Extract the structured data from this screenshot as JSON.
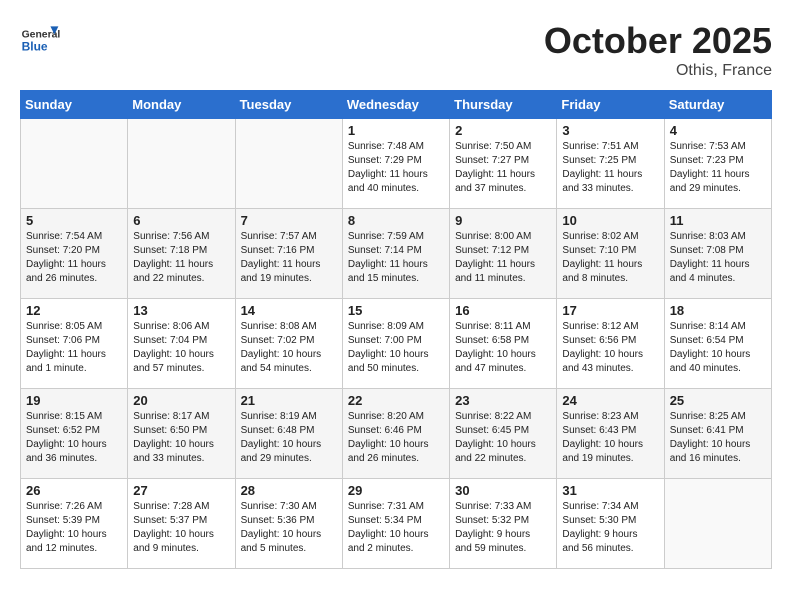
{
  "header": {
    "logo_general": "General",
    "logo_blue": "Blue",
    "month": "October 2025",
    "location": "Othis, France"
  },
  "weekdays": [
    "Sunday",
    "Monday",
    "Tuesday",
    "Wednesday",
    "Thursday",
    "Friday",
    "Saturday"
  ],
  "weeks": [
    [
      {
        "day": "",
        "data": ""
      },
      {
        "day": "",
        "data": ""
      },
      {
        "day": "",
        "data": ""
      },
      {
        "day": "1",
        "data": "Sunrise: 7:48 AM\nSunset: 7:29 PM\nDaylight: 11 hours\nand 40 minutes."
      },
      {
        "day": "2",
        "data": "Sunrise: 7:50 AM\nSunset: 7:27 PM\nDaylight: 11 hours\nand 37 minutes."
      },
      {
        "day": "3",
        "data": "Sunrise: 7:51 AM\nSunset: 7:25 PM\nDaylight: 11 hours\nand 33 minutes."
      },
      {
        "day": "4",
        "data": "Sunrise: 7:53 AM\nSunset: 7:23 PM\nDaylight: 11 hours\nand 29 minutes."
      }
    ],
    [
      {
        "day": "5",
        "data": "Sunrise: 7:54 AM\nSunset: 7:20 PM\nDaylight: 11 hours\nand 26 minutes."
      },
      {
        "day": "6",
        "data": "Sunrise: 7:56 AM\nSunset: 7:18 PM\nDaylight: 11 hours\nand 22 minutes."
      },
      {
        "day": "7",
        "data": "Sunrise: 7:57 AM\nSunset: 7:16 PM\nDaylight: 11 hours\nand 19 minutes."
      },
      {
        "day": "8",
        "data": "Sunrise: 7:59 AM\nSunset: 7:14 PM\nDaylight: 11 hours\nand 15 minutes."
      },
      {
        "day": "9",
        "data": "Sunrise: 8:00 AM\nSunset: 7:12 PM\nDaylight: 11 hours\nand 11 minutes."
      },
      {
        "day": "10",
        "data": "Sunrise: 8:02 AM\nSunset: 7:10 PM\nDaylight: 11 hours\nand 8 minutes."
      },
      {
        "day": "11",
        "data": "Sunrise: 8:03 AM\nSunset: 7:08 PM\nDaylight: 11 hours\nand 4 minutes."
      }
    ],
    [
      {
        "day": "12",
        "data": "Sunrise: 8:05 AM\nSunset: 7:06 PM\nDaylight: 11 hours\nand 1 minute."
      },
      {
        "day": "13",
        "data": "Sunrise: 8:06 AM\nSunset: 7:04 PM\nDaylight: 10 hours\nand 57 minutes."
      },
      {
        "day": "14",
        "data": "Sunrise: 8:08 AM\nSunset: 7:02 PM\nDaylight: 10 hours\nand 54 minutes."
      },
      {
        "day": "15",
        "data": "Sunrise: 8:09 AM\nSunset: 7:00 PM\nDaylight: 10 hours\nand 50 minutes."
      },
      {
        "day": "16",
        "data": "Sunrise: 8:11 AM\nSunset: 6:58 PM\nDaylight: 10 hours\nand 47 minutes."
      },
      {
        "day": "17",
        "data": "Sunrise: 8:12 AM\nSunset: 6:56 PM\nDaylight: 10 hours\nand 43 minutes."
      },
      {
        "day": "18",
        "data": "Sunrise: 8:14 AM\nSunset: 6:54 PM\nDaylight: 10 hours\nand 40 minutes."
      }
    ],
    [
      {
        "day": "19",
        "data": "Sunrise: 8:15 AM\nSunset: 6:52 PM\nDaylight: 10 hours\nand 36 minutes."
      },
      {
        "day": "20",
        "data": "Sunrise: 8:17 AM\nSunset: 6:50 PM\nDaylight: 10 hours\nand 33 minutes."
      },
      {
        "day": "21",
        "data": "Sunrise: 8:19 AM\nSunset: 6:48 PM\nDaylight: 10 hours\nand 29 minutes."
      },
      {
        "day": "22",
        "data": "Sunrise: 8:20 AM\nSunset: 6:46 PM\nDaylight: 10 hours\nand 26 minutes."
      },
      {
        "day": "23",
        "data": "Sunrise: 8:22 AM\nSunset: 6:45 PM\nDaylight: 10 hours\nand 22 minutes."
      },
      {
        "day": "24",
        "data": "Sunrise: 8:23 AM\nSunset: 6:43 PM\nDaylight: 10 hours\nand 19 minutes."
      },
      {
        "day": "25",
        "data": "Sunrise: 8:25 AM\nSunset: 6:41 PM\nDaylight: 10 hours\nand 16 minutes."
      }
    ],
    [
      {
        "day": "26",
        "data": "Sunrise: 7:26 AM\nSunset: 5:39 PM\nDaylight: 10 hours\nand 12 minutes."
      },
      {
        "day": "27",
        "data": "Sunrise: 7:28 AM\nSunset: 5:37 PM\nDaylight: 10 hours\nand 9 minutes."
      },
      {
        "day": "28",
        "data": "Sunrise: 7:30 AM\nSunset: 5:36 PM\nDaylight: 10 hours\nand 5 minutes."
      },
      {
        "day": "29",
        "data": "Sunrise: 7:31 AM\nSunset: 5:34 PM\nDaylight: 10 hours\nand 2 minutes."
      },
      {
        "day": "30",
        "data": "Sunrise: 7:33 AM\nSunset: 5:32 PM\nDaylight: 9 hours\nand 59 minutes."
      },
      {
        "day": "31",
        "data": "Sunrise: 7:34 AM\nSunset: 5:30 PM\nDaylight: 9 hours\nand 56 minutes."
      },
      {
        "day": "",
        "data": ""
      }
    ]
  ]
}
